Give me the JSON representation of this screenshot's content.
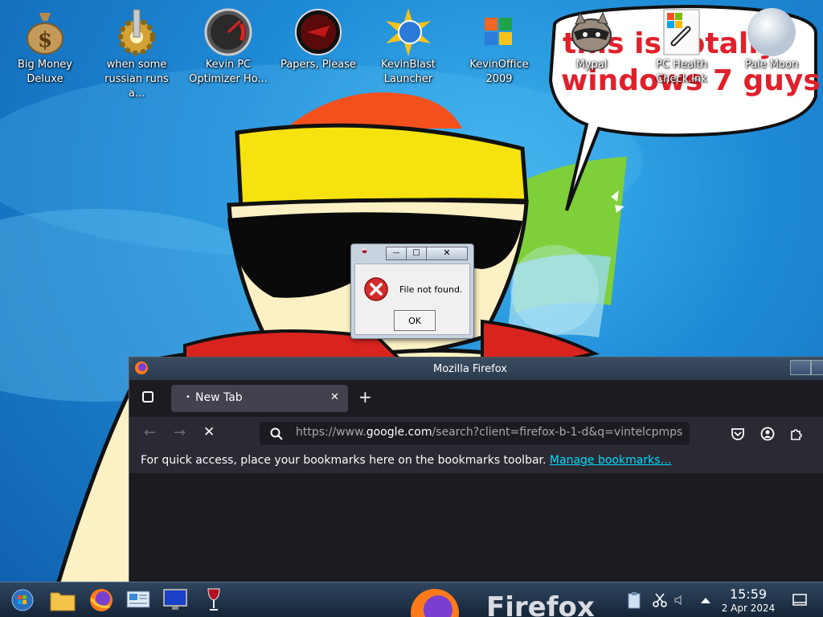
{
  "desktop_icons": [
    {
      "label": "Big Money Deluxe",
      "icon": "money-bag-icon"
    },
    {
      "label": "when some russian runs a...",
      "icon": "gear-icon"
    },
    {
      "label": "Kevin PC Optimizer Ho...",
      "icon": "speedometer-icon"
    },
    {
      "label": "Papers, Please",
      "icon": "papers-please-icon"
    },
    {
      "label": "KevinBlast Launcher",
      "icon": "starburst-icon"
    },
    {
      "label": "KevinOffice 2009",
      "icon": "office-logo-icon"
    },
    {
      "label": "Mypal",
      "icon": "raccoon-icon"
    },
    {
      "label": "PC Health Check.lnk",
      "icon": "shortcut-link-icon"
    },
    {
      "label": "Pale Moon",
      "icon": "moon-icon"
    }
  ],
  "wallpaper": {
    "speech_bubble_text_line1": "this is totally",
    "speech_bubble_text_line2": "windows 7 guys"
  },
  "dialog": {
    "message": "File not found.",
    "ok_label": "OK",
    "minimize_glyph": "—",
    "maximize_glyph": "□",
    "close_glyph": "✕"
  },
  "firefox": {
    "window_title": "Mozilla Firefox",
    "tab_label": "New Tab",
    "tab_close_glyph": "✕",
    "new_tab_glyph": "+",
    "url_prefix": "https://www.",
    "url_domain": "google.com",
    "url_rest": "/search?client=firefox-b-1-d&q=vintelcpmps",
    "bookmarks_message": "For quick access, place your bookmarks here on the bookmarks toolbar.",
    "manage_bookmarks_link": "Manage bookmarks…",
    "back_glyph": "←",
    "forward_glyph": "→",
    "stop_glyph": "✕",
    "watermark": "Firefox"
  },
  "taskbar": {
    "time": "15:59",
    "date": "2 Apr 2024",
    "pinned": [
      "start-orb-icon",
      "file-explorer-icon",
      "firefox-icon",
      "control-panel-icon",
      "monitor-icon",
      "wine-glass-icon"
    ]
  },
  "colors": {
    "firefox_link": "#00ddff",
    "dialog_error": "#d52b2b",
    "bubble_text": "#e0202a"
  }
}
